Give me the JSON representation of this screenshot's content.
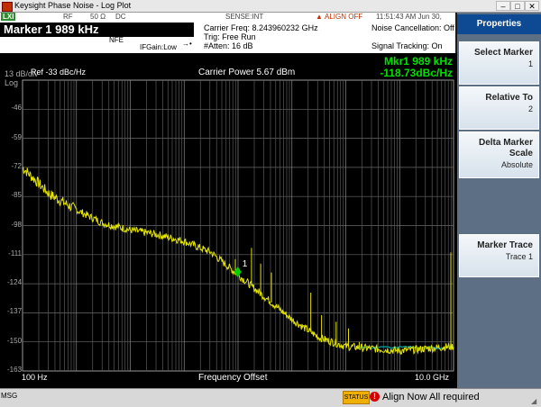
{
  "window": {
    "title": "Keysight Phase Noise - Log Plot",
    "minimize": "–",
    "maximize": "□",
    "close": "✕"
  },
  "status": {
    "lxi": "LXI",
    "rf": "RF",
    "impedance": "50 Ω",
    "coupling": "DC",
    "sense": "SENSE:INT",
    "align": "ALIGN OFF",
    "timestamp": "11:51:43 AM Jun 30, 2020"
  },
  "info": {
    "marker_header": "Marker 1  989 kHz",
    "nfe": "NFE",
    "ifgain": "IFGain:Low",
    "carrier_freq": "Carrier Freq: 8.243960232 GHz",
    "trig": "Trig: Free Run",
    "atten": "#Atten: 16 dB",
    "noise_cancel": "Noise Cancellation: Off",
    "signal_tracking": "Signal Tracking: On"
  },
  "plot": {
    "scale": "13 dB/div",
    "scale_mode": "Log",
    "ref": "Ref  -33 dBc/Hz",
    "carrier_power": "Carrier Power 5.67 dBm",
    "marker_freq": "Mkr1 989 kHz",
    "marker_value": "-118.73dBc/Hz",
    "marker_label": "1",
    "x_start": "100 Hz",
    "x_label": "Frequency Offset",
    "x_stop": "10.0 GHz",
    "y_ticks": [
      "-46",
      "-59",
      "-72",
      "-85",
      "-98",
      "-111",
      "-124",
      "-137",
      "-150",
      "-163"
    ]
  },
  "properties": {
    "header": "Properties",
    "keys": [
      {
        "label": "Select Marker",
        "value": "1"
      },
      {
        "label": "Relative To",
        "value": "2"
      },
      {
        "label": "Delta Marker Scale",
        "value": "Absolute"
      },
      {
        "label": "Marker Trace",
        "value": "Trace 1"
      }
    ]
  },
  "message": {
    "msg": "MSG",
    "status": "STATUS",
    "warning_icon": "!",
    "text": "Align Now All required"
  },
  "colors": {
    "trace": "#e6e600",
    "reference_trace": "#00a6a6",
    "marker": "#00d000",
    "softkey_header": "#0e4a93"
  },
  "chart_data": {
    "type": "line",
    "xscale": "log",
    "x_range": [
      "100 Hz",
      "10.0 GHz"
    ],
    "ylim": [
      -163,
      -33
    ],
    "ylabel_unit": "dBc/Hz",
    "x": [
      "100 Hz",
      "300 Hz",
      "1 kHz",
      "3 kHz",
      "10 kHz",
      "30 kHz",
      "100 kHz",
      "300 kHz",
      "1 MHz",
      "3 MHz",
      "10 MHz",
      "30 MHz",
      "100 MHz",
      "300 MHz",
      "1 GHz",
      "3 GHz",
      "10 GHz"
    ],
    "series": [
      {
        "values": [
          -72,
          -84,
          -91,
          -97,
          -100,
          -102,
          -105,
          -110,
          -120,
          -130,
          -140,
          -148,
          -152,
          -153,
          -154,
          -153,
          -152
        ]
      }
    ],
    "marker": {
      "x": "989 kHz",
      "y": -118.73
    }
  }
}
